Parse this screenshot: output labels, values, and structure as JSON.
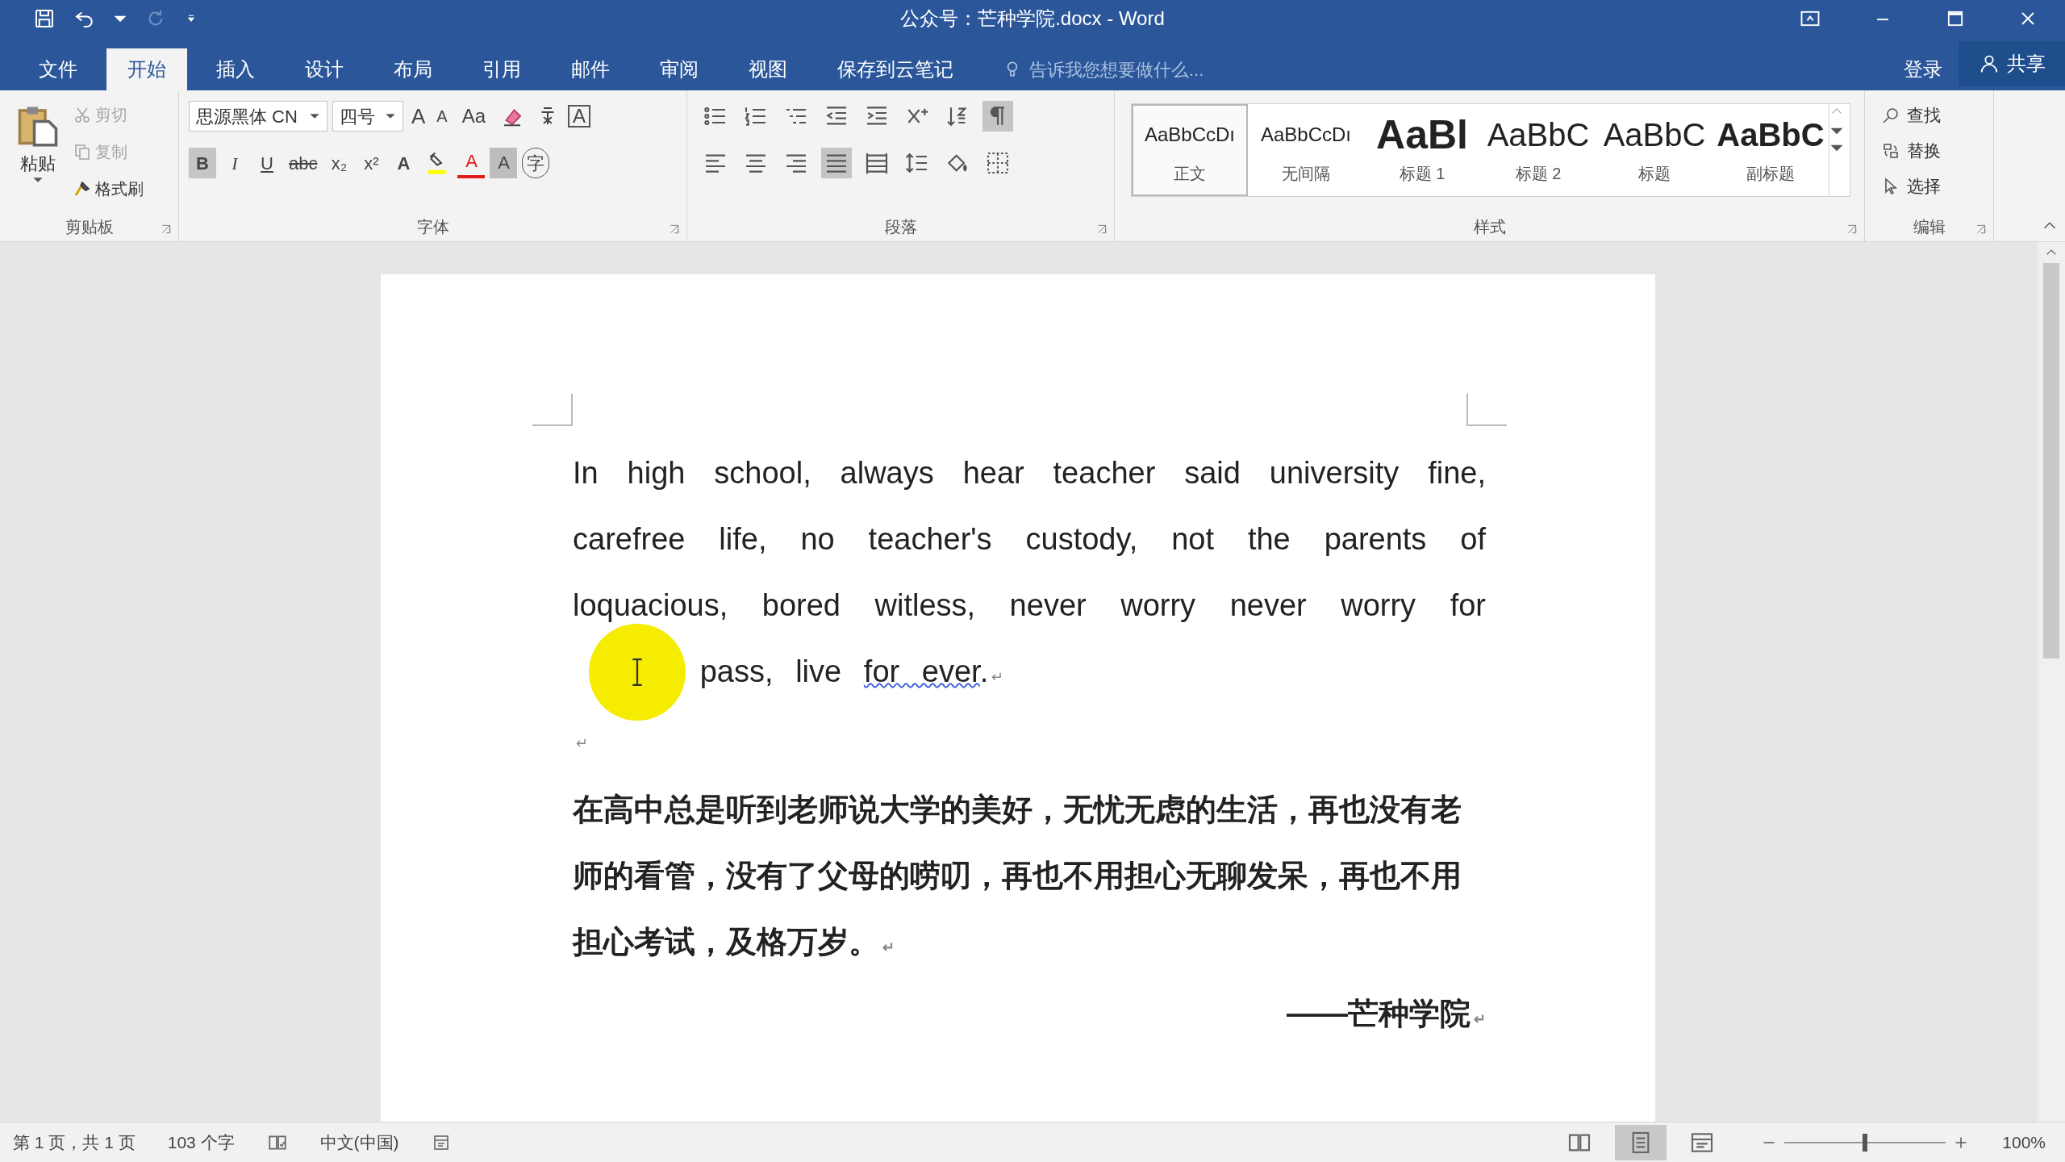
{
  "window": {
    "title": "公众号：芒种学院.docx - Word"
  },
  "quick_access": [
    {
      "kind": "save",
      "disabled": false
    },
    {
      "kind": "undo",
      "disabled": false
    },
    {
      "kind": "undo_menu",
      "disabled": false
    },
    {
      "kind": "redo",
      "disabled": true
    },
    {
      "kind": "customize",
      "disabled": false
    }
  ],
  "tabs": [
    {
      "label": "文件",
      "selected": false
    },
    {
      "label": "开始",
      "selected": true
    },
    {
      "label": "插入",
      "selected": false
    },
    {
      "label": "设计",
      "selected": false
    },
    {
      "label": "布局",
      "selected": false
    },
    {
      "label": "引用",
      "selected": false
    },
    {
      "label": "邮件",
      "selected": false
    },
    {
      "label": "审阅",
      "selected": false
    },
    {
      "label": "视图",
      "selected": false
    },
    {
      "label": "保存到云笔记",
      "selected": false
    }
  ],
  "tell_me": {
    "placeholder": "告诉我您想要做什么..."
  },
  "account": {
    "sign_in": "登录",
    "share": "共享"
  },
  "clipboard": {
    "label": "剪贴板",
    "paste": "粘贴",
    "tools": [
      {
        "kind": "cut",
        "label": "剪切",
        "disabled": true
      },
      {
        "kind": "copy",
        "label": "复制",
        "disabled": true
      },
      {
        "kind": "painter",
        "label": "格式刷",
        "disabled": false
      }
    ]
  },
  "font": {
    "label": "字体",
    "font_name": "思源黑体 CN",
    "font_size": "四号",
    "row1": [
      {
        "kind": "grow",
        "label": "A"
      },
      {
        "kind": "shrink",
        "label": "A"
      },
      {
        "kind": "case",
        "label": "Aa"
      },
      {
        "kind": "clear"
      },
      {
        "kind": "phonetic"
      },
      {
        "kind": "border",
        "label": "A"
      }
    ],
    "row2": [
      {
        "kind": "bold",
        "label": "B",
        "selected": true
      },
      {
        "kind": "italic",
        "label": "I",
        "selected": false
      },
      {
        "kind": "underline",
        "label": "U",
        "selected": false
      },
      {
        "kind": "strike",
        "label": "abc",
        "selected": false
      },
      {
        "kind": "sub",
        "label": "x₂",
        "selected": false
      },
      {
        "kind": "sup",
        "label": "x²",
        "selected": false
      },
      {
        "kind": "effects",
        "label": "A"
      },
      {
        "kind": "highlight"
      },
      {
        "kind": "color",
        "label": "A"
      },
      {
        "kind": "shading",
        "label": "A"
      },
      {
        "kind": "enclose",
        "label": "字"
      }
    ]
  },
  "paragraph": {
    "label": "段落",
    "row1": [
      {
        "kind": "bullets"
      },
      {
        "kind": "numbering"
      },
      {
        "kind": "multilevel"
      },
      {
        "kind": "outdent"
      },
      {
        "kind": "indent"
      },
      {
        "kind": "asian"
      },
      {
        "kind": "sort"
      },
      {
        "kind": "marks",
        "selected": true
      }
    ],
    "row2": [
      {
        "kind": "align_left",
        "selected": false
      },
      {
        "kind": "align_center",
        "selected": false
      },
      {
        "kind": "align_right",
        "selected": false
      },
      {
        "kind": "justify",
        "selected": true
      },
      {
        "kind": "distribute",
        "selected": false
      },
      {
        "kind": "spacing"
      },
      {
        "kind": "fill"
      },
      {
        "kind": "borders"
      }
    ]
  },
  "styles": {
    "label": "样式",
    "items": [
      {
        "kind": "body",
        "preview": "AaBbCcDı",
        "name": "正文",
        "selected": true
      },
      {
        "kind": "body",
        "preview": "AaBbCcDı",
        "name": "无间隔",
        "selected": false
      },
      {
        "kind": "heading1",
        "preview": "AaBl",
        "name": "标题 1",
        "selected": false
      },
      {
        "kind": "heading2",
        "preview": "AaBbC",
        "name": "标题 2",
        "selected": false
      },
      {
        "kind": "heading2",
        "preview": "AaBbC",
        "name": "标题",
        "selected": false
      },
      {
        "kind": "subtitle",
        "preview": "AaBbC",
        "name": "副标题",
        "selected": false
      }
    ]
  },
  "editing": {
    "label": "编辑",
    "tools": [
      {
        "kind": "find",
        "label": "查找"
      },
      {
        "kind": "replace",
        "label": "替换"
      },
      {
        "kind": "select",
        "label": "选择"
      }
    ]
  },
  "document": {
    "paragraphs": [
      {
        "kind": "english",
        "mark": "↵",
        "segments": [
          {
            "kind": "text",
            "text": "In high school, always hear teacher said university fine, carefree life, no teacher's custody, not the parents of loquacious, bored witless, never worry never worry for"
          },
          {
            "kind": "cursor"
          },
          {
            "kind": "text",
            "text": "pass, live "
          },
          {
            "kind": "flagged",
            "text": "for ever"
          },
          {
            "kind": "text",
            "text": "."
          }
        ]
      },
      {
        "kind": "empty",
        "mark": "↵"
      },
      {
        "kind": "chinese",
        "mark": "↵",
        "segments": [
          {
            "kind": "text",
            "text": "在高中总是听到老师说大学的美好，无忧无虑的生活，再也没有老师的看管，没有了父母的唠叨，再也不用担心无聊发呆，再也不用担心考试，及格万岁。"
          }
        ]
      },
      {
        "kind": "signature",
        "mark": "↵",
        "segments": [
          {
            "kind": "text",
            "text": "——芒种学院"
          }
        ]
      }
    ]
  },
  "status_bar": {
    "page": "第 1 页，共 1 页",
    "words": "103 个字",
    "language": "中文(中国)",
    "views": [
      {
        "kind": "read",
        "selected": false
      },
      {
        "kind": "print",
        "selected": true
      },
      {
        "kind": "web",
        "selected": false
      }
    ],
    "zoom": {
      "level": 0.5,
      "label": "100%"
    }
  }
}
